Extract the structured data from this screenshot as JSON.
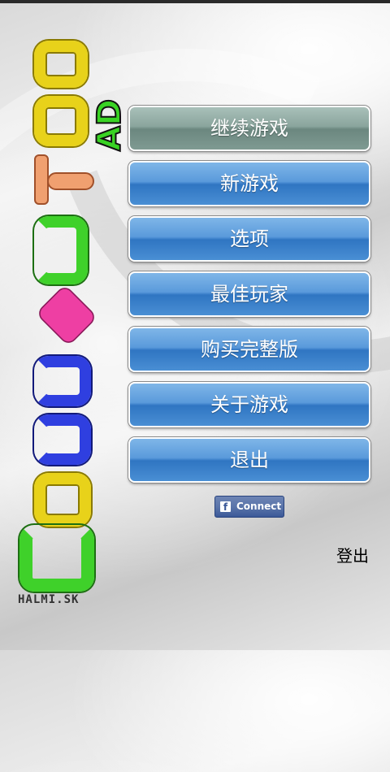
{
  "app": {
    "logo_credit": "HALMI.SK",
    "logo_badge": "AD",
    "logo_letters": [
      {
        "name": "logo-letter-o-1",
        "color": "#e8d21a"
      },
      {
        "name": "logo-letter-o-2",
        "color": "#e8d21a"
      },
      {
        "name": "logo-letter-t",
        "color": "#f0a070"
      },
      {
        "name": "logo-letter-c",
        "color": "#3fd12a"
      },
      {
        "name": "logo-letter-e",
        "color": "#ee3fa3"
      },
      {
        "name": "logo-letter-n-1",
        "color": "#2f3fe0"
      },
      {
        "name": "logo-letter-n-2",
        "color": "#2f3fe0"
      },
      {
        "name": "logo-letter-o-3",
        "color": "#e8d21a"
      },
      {
        "name": "logo-letter-c-2",
        "color": "#3fd12a"
      }
    ]
  },
  "menu": {
    "continue_game": "继续游戏",
    "new_game": "新游戏",
    "options": "选项",
    "high_scores": "最佳玩家",
    "buy_full_version": "购买完整版",
    "about_game": "关于游戏",
    "exit": "退出"
  },
  "facebook": {
    "icon": "facebook-icon",
    "icon_glyph": "f",
    "label": "Connect",
    "color": "#3b5998"
  },
  "account": {
    "logout": "登出"
  }
}
